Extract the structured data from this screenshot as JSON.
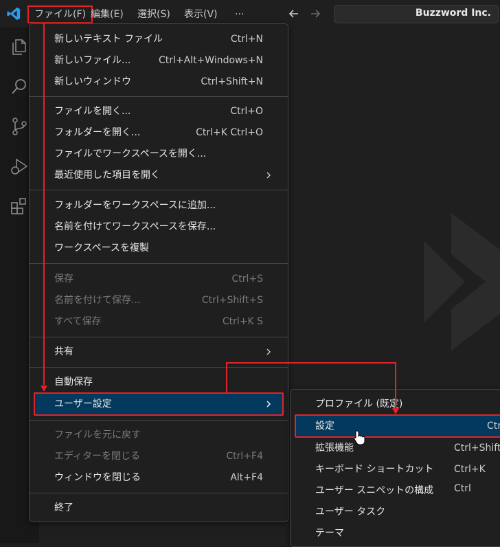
{
  "menubar": {
    "items": [
      "ファイル(F)",
      "編集(E)",
      "選択(S)",
      "表示(V)",
      "···"
    ]
  },
  "command_center": {
    "label": "Buzzword Inc."
  },
  "file_menu": {
    "groups": [
      [
        {
          "label": "新しいテキスト ファイル",
          "key": "Ctrl+N"
        },
        {
          "label": "新しいファイル...",
          "key": "Ctrl+Alt+Windows+N"
        },
        {
          "label": "新しいウィンドウ",
          "key": "Ctrl+Shift+N"
        }
      ],
      [
        {
          "label": "ファイルを開く...",
          "key": "Ctrl+O"
        },
        {
          "label": "フォルダーを開く...",
          "key": "Ctrl+K Ctrl+O"
        },
        {
          "label": "ファイルでワークスペースを開く...",
          "key": ""
        },
        {
          "label": "最近使用した項目を開く",
          "key": ""
        }
      ],
      [
        {
          "label": "フォルダーをワークスペースに追加...",
          "key": ""
        },
        {
          "label": "名前を付けてワークスペースを保存...",
          "key": ""
        },
        {
          "label": "ワークスペースを複製",
          "key": ""
        }
      ],
      [
        {
          "label": "保存",
          "key": "Ctrl+S"
        },
        {
          "label": "名前を付けて保存...",
          "key": "Ctrl+Shift+S"
        },
        {
          "label": "すべて保存",
          "key": "Ctrl+K S"
        }
      ],
      [
        {
          "label": "共有",
          "key": ""
        }
      ],
      [
        {
          "label": "自動保存",
          "key": ""
        },
        {
          "label": "ユーザー設定",
          "key": ""
        }
      ],
      [
        {
          "label": "ファイルを元に戻す",
          "key": ""
        },
        {
          "label": "エディターを閉じる",
          "key": "Ctrl+F4"
        },
        {
          "label": "ウィンドウを閉じる",
          "key": "Alt+F4"
        }
      ],
      [
        {
          "label": "終了",
          "key": ""
        }
      ]
    ]
  },
  "preferences_submenu": {
    "items": [
      {
        "label": "プロファイル (既定)",
        "key": ""
      },
      {
        "label": "設定",
        "key": "Ctr"
      },
      {
        "label": "拡張機能",
        "key": "Ctrl+Shift"
      },
      {
        "label": "キーボード ショートカット",
        "key": "Ctrl+K Ctrl"
      },
      {
        "label": "ユーザー スニペットの構成",
        "key": ""
      },
      {
        "label": "ユーザー タスク",
        "key": ""
      },
      {
        "label": "テーマ",
        "key": ""
      }
    ]
  },
  "colors": {
    "accent": "#04395e",
    "annotation": "#e0242b",
    "background": "#1f1f1f"
  }
}
